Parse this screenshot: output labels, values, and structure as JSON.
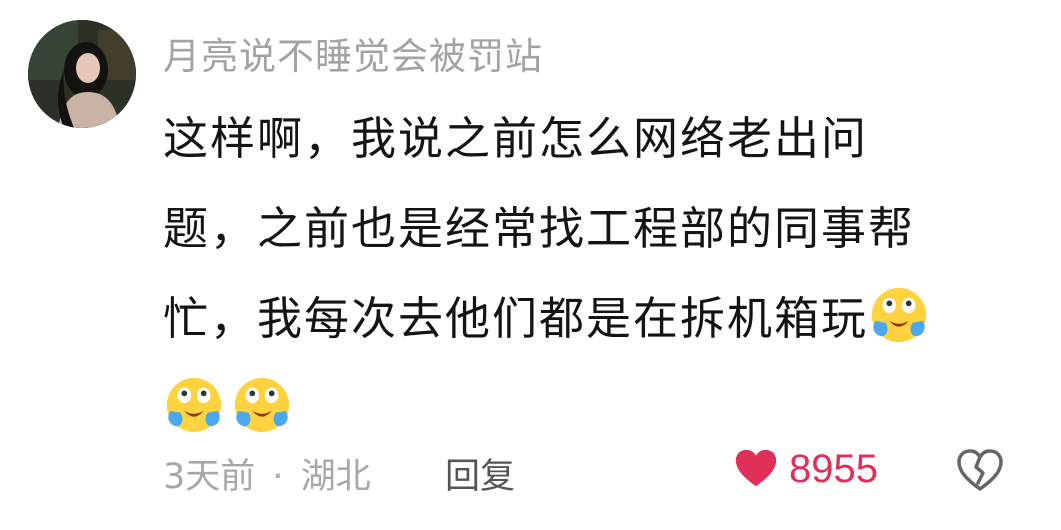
{
  "comment": {
    "username": "月亮说不睡觉会被罚站",
    "lines": [
      "这样啊，我说之前怎么网络老出问",
      "题，之前也是经常找工程部的同事帮",
      "忙，我每次去他们都是在拆机箱玩"
    ],
    "emoji_name": "crying-laughing-emoji",
    "time": "3天前",
    "separator": "·",
    "location": "湖北",
    "reply_label": "回复",
    "like_count": "8955"
  },
  "colors": {
    "username": "#a3a3a3",
    "text": "#141414",
    "meta": "#a8a8a8",
    "like": "#e0305a"
  }
}
